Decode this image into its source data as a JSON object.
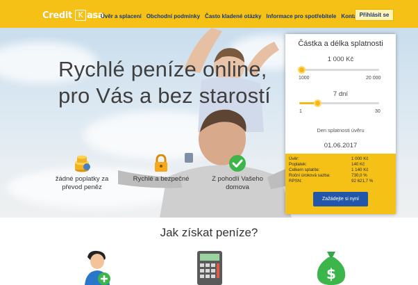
{
  "header": {
    "logo": {
      "credit": "Credit",
      "k": "K",
      "asa": "asa"
    },
    "nav": [
      {
        "label": "Úvěr a splacení"
      },
      {
        "label": "Obchodní podmínky"
      },
      {
        "label": "Často kladené otázky"
      },
      {
        "label": "Informace pro spotřebitele"
      },
      {
        "label": "Kontakty"
      }
    ],
    "login_label": "Přihlásit se"
  },
  "hero": {
    "headline_line1": "Rychlé peníze online,",
    "headline_line2": "pro Vás a bez starostí",
    "features": [
      {
        "line1": "žádné poplatky za",
        "line2": "převod peněz",
        "icon": "coins-icon"
      },
      {
        "line1": "Rychlé a bezpečné",
        "line2": "",
        "icon": "lock-icon"
      },
      {
        "line1": "Z pohodlí Vašeho",
        "line2": "domova",
        "icon": "check-icon"
      }
    ]
  },
  "calculator": {
    "title": "Částka a délka splatnosti",
    "amount": "1 000 Kč",
    "amount_min": "1000",
    "amount_max": "20 000",
    "amount_level": 0.0,
    "days": "7 dní",
    "days_min": "1",
    "days_max": "30",
    "days_level": 0.2,
    "due_label": "Den splatnosti úvěru",
    "due_date": "01.06.2017",
    "summary": [
      {
        "label": "Úvěr:",
        "value": "1 000 Kč"
      },
      {
        "label": "Poplatek:",
        "value": "140 Kč"
      },
      {
        "label": "Celkem splatíte:",
        "value": "1 140 Kč"
      },
      {
        "label": "Roční úroková sazba:",
        "value": "730,0 %"
      },
      {
        "label": "RPSN:",
        "value": "92 621,7 %"
      }
    ],
    "apply_label": "Zažádejte si nyní"
  },
  "how": {
    "title": "Jak získat peníze?",
    "icons": [
      "add-user-icon",
      "calculator-icon",
      "money-bag-icon"
    ]
  },
  "colors": {
    "accent": "#f6c117",
    "nav_text": "#173a6e",
    "button": "#2256a8"
  }
}
